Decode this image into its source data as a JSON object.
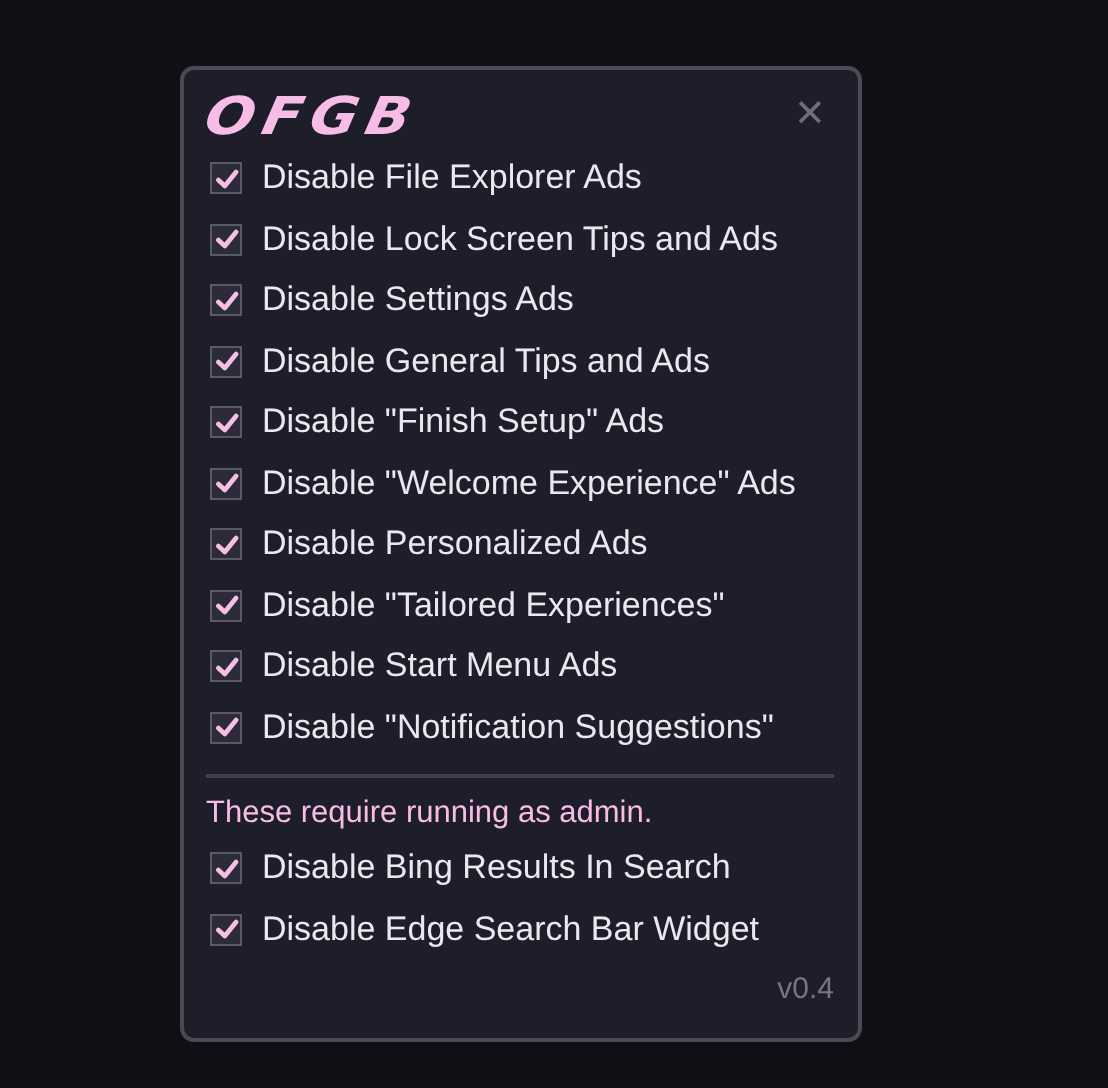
{
  "window": {
    "title": "OFGB",
    "close": "✕"
  },
  "options": [
    {
      "label": "Disable File Explorer Ads",
      "checked": true
    },
    {
      "label": "Disable Lock Screen Tips and Ads",
      "checked": true
    },
    {
      "label": "Disable Settings Ads",
      "checked": true
    },
    {
      "label": "Disable General Tips and Ads",
      "checked": true
    },
    {
      "label": "Disable \"Finish Setup\" Ads",
      "checked": true
    },
    {
      "label": "Disable \"Welcome Experience\" Ads",
      "checked": true
    },
    {
      "label": "Disable Personalized Ads",
      "checked": true
    },
    {
      "label": "Disable \"Tailored Experiences\"",
      "checked": true
    },
    {
      "label": "Disable Start Menu Ads",
      "checked": true
    },
    {
      "label": "Disable \"Notification Suggestions\"",
      "checked": true
    }
  ],
  "admin_note": "These require running as admin.",
  "admin_options": [
    {
      "label": "Disable Bing Results In Search",
      "checked": true
    },
    {
      "label": "Disable Edge Search Bar Widget",
      "checked": true
    }
  ],
  "version": "v0.4"
}
